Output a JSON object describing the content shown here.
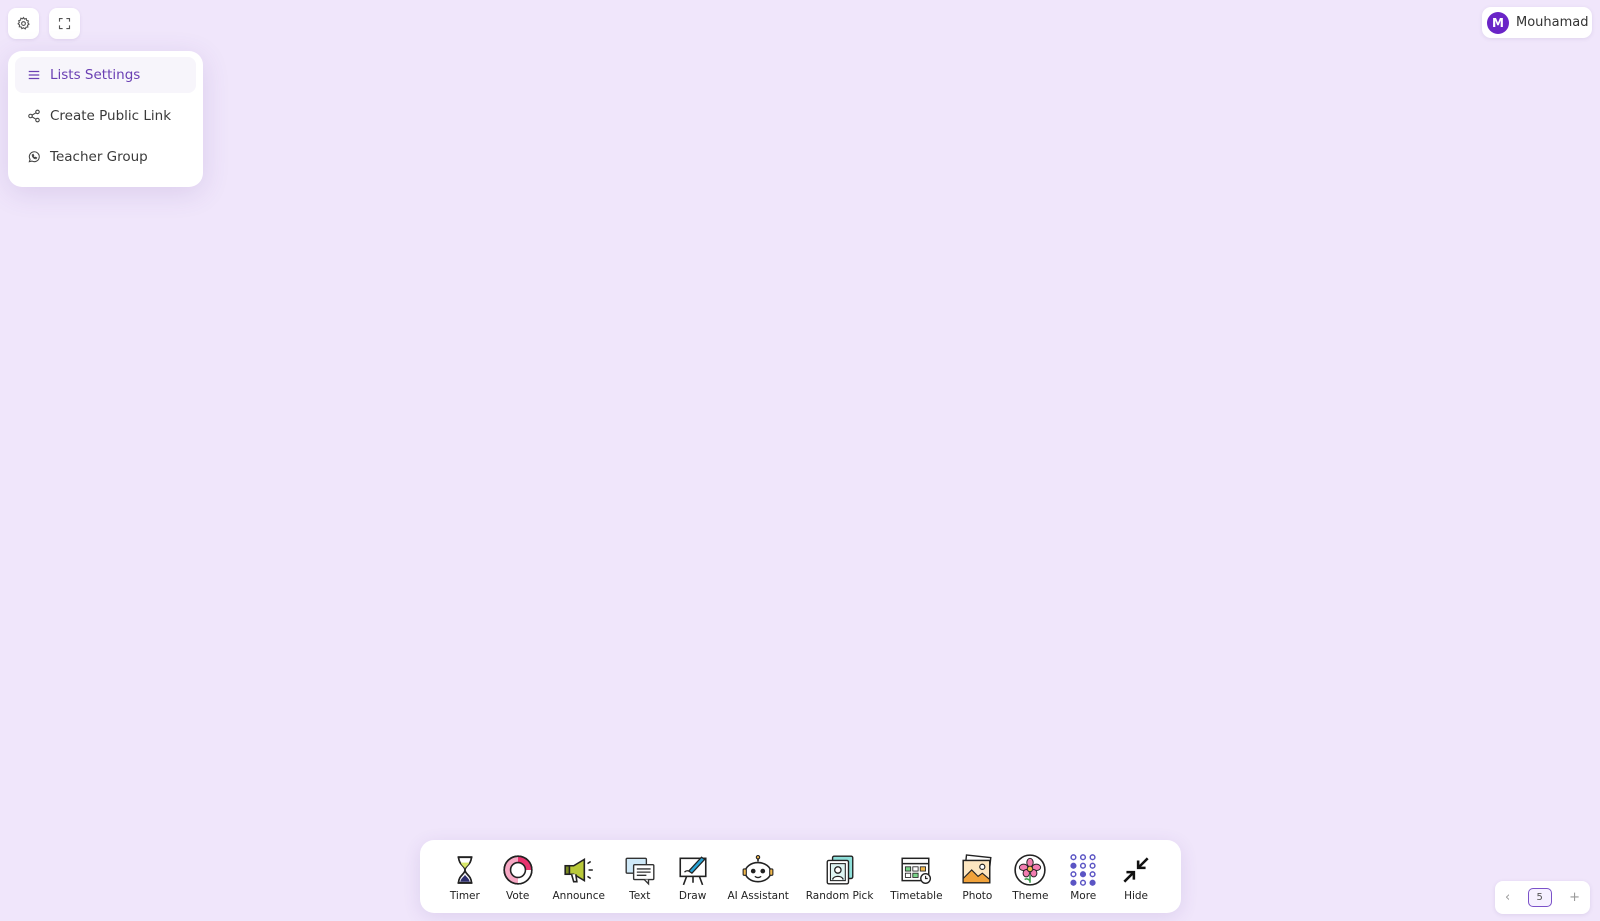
{
  "top_controls": {
    "settings_icon": "gear-icon",
    "fullscreen_icon": "expand-icon"
  },
  "menu": {
    "items": [
      {
        "label": "Lists Settings",
        "icon": "menu-lines-icon",
        "active": true
      },
      {
        "label": "Create Public Link",
        "icon": "share-icon",
        "active": false
      },
      {
        "label": "Teacher Group",
        "icon": "whatsapp-icon",
        "active": false
      }
    ]
  },
  "user": {
    "initial": "M",
    "name": "Mouhamad",
    "avatar_color": "#6a24c7"
  },
  "toolbar": {
    "tools": [
      {
        "label": "Timer",
        "icon": "hourglass-icon"
      },
      {
        "label": "Vote",
        "icon": "vote-ring-icon"
      },
      {
        "label": "Announce",
        "icon": "megaphone-icon"
      },
      {
        "label": "Text",
        "icon": "text-bubble-icon"
      },
      {
        "label": "Draw",
        "icon": "easel-icon"
      },
      {
        "label": "AI Assistant",
        "icon": "robot-icon"
      },
      {
        "label": "Random Pick",
        "icon": "random-pick-icon"
      },
      {
        "label": "Timetable",
        "icon": "timetable-icon"
      },
      {
        "label": "Photo",
        "icon": "photo-icon"
      },
      {
        "label": "Theme",
        "icon": "flower-theme-icon"
      },
      {
        "label": "More",
        "icon": "dots-grid-icon"
      },
      {
        "label": "Hide",
        "icon": "collapse-arrows-icon"
      }
    ]
  },
  "pager": {
    "prev": "‹",
    "page": "5",
    "add": "+"
  },
  "colors": {
    "background": "#f0e6fb",
    "accent": "#6a3fb3"
  }
}
